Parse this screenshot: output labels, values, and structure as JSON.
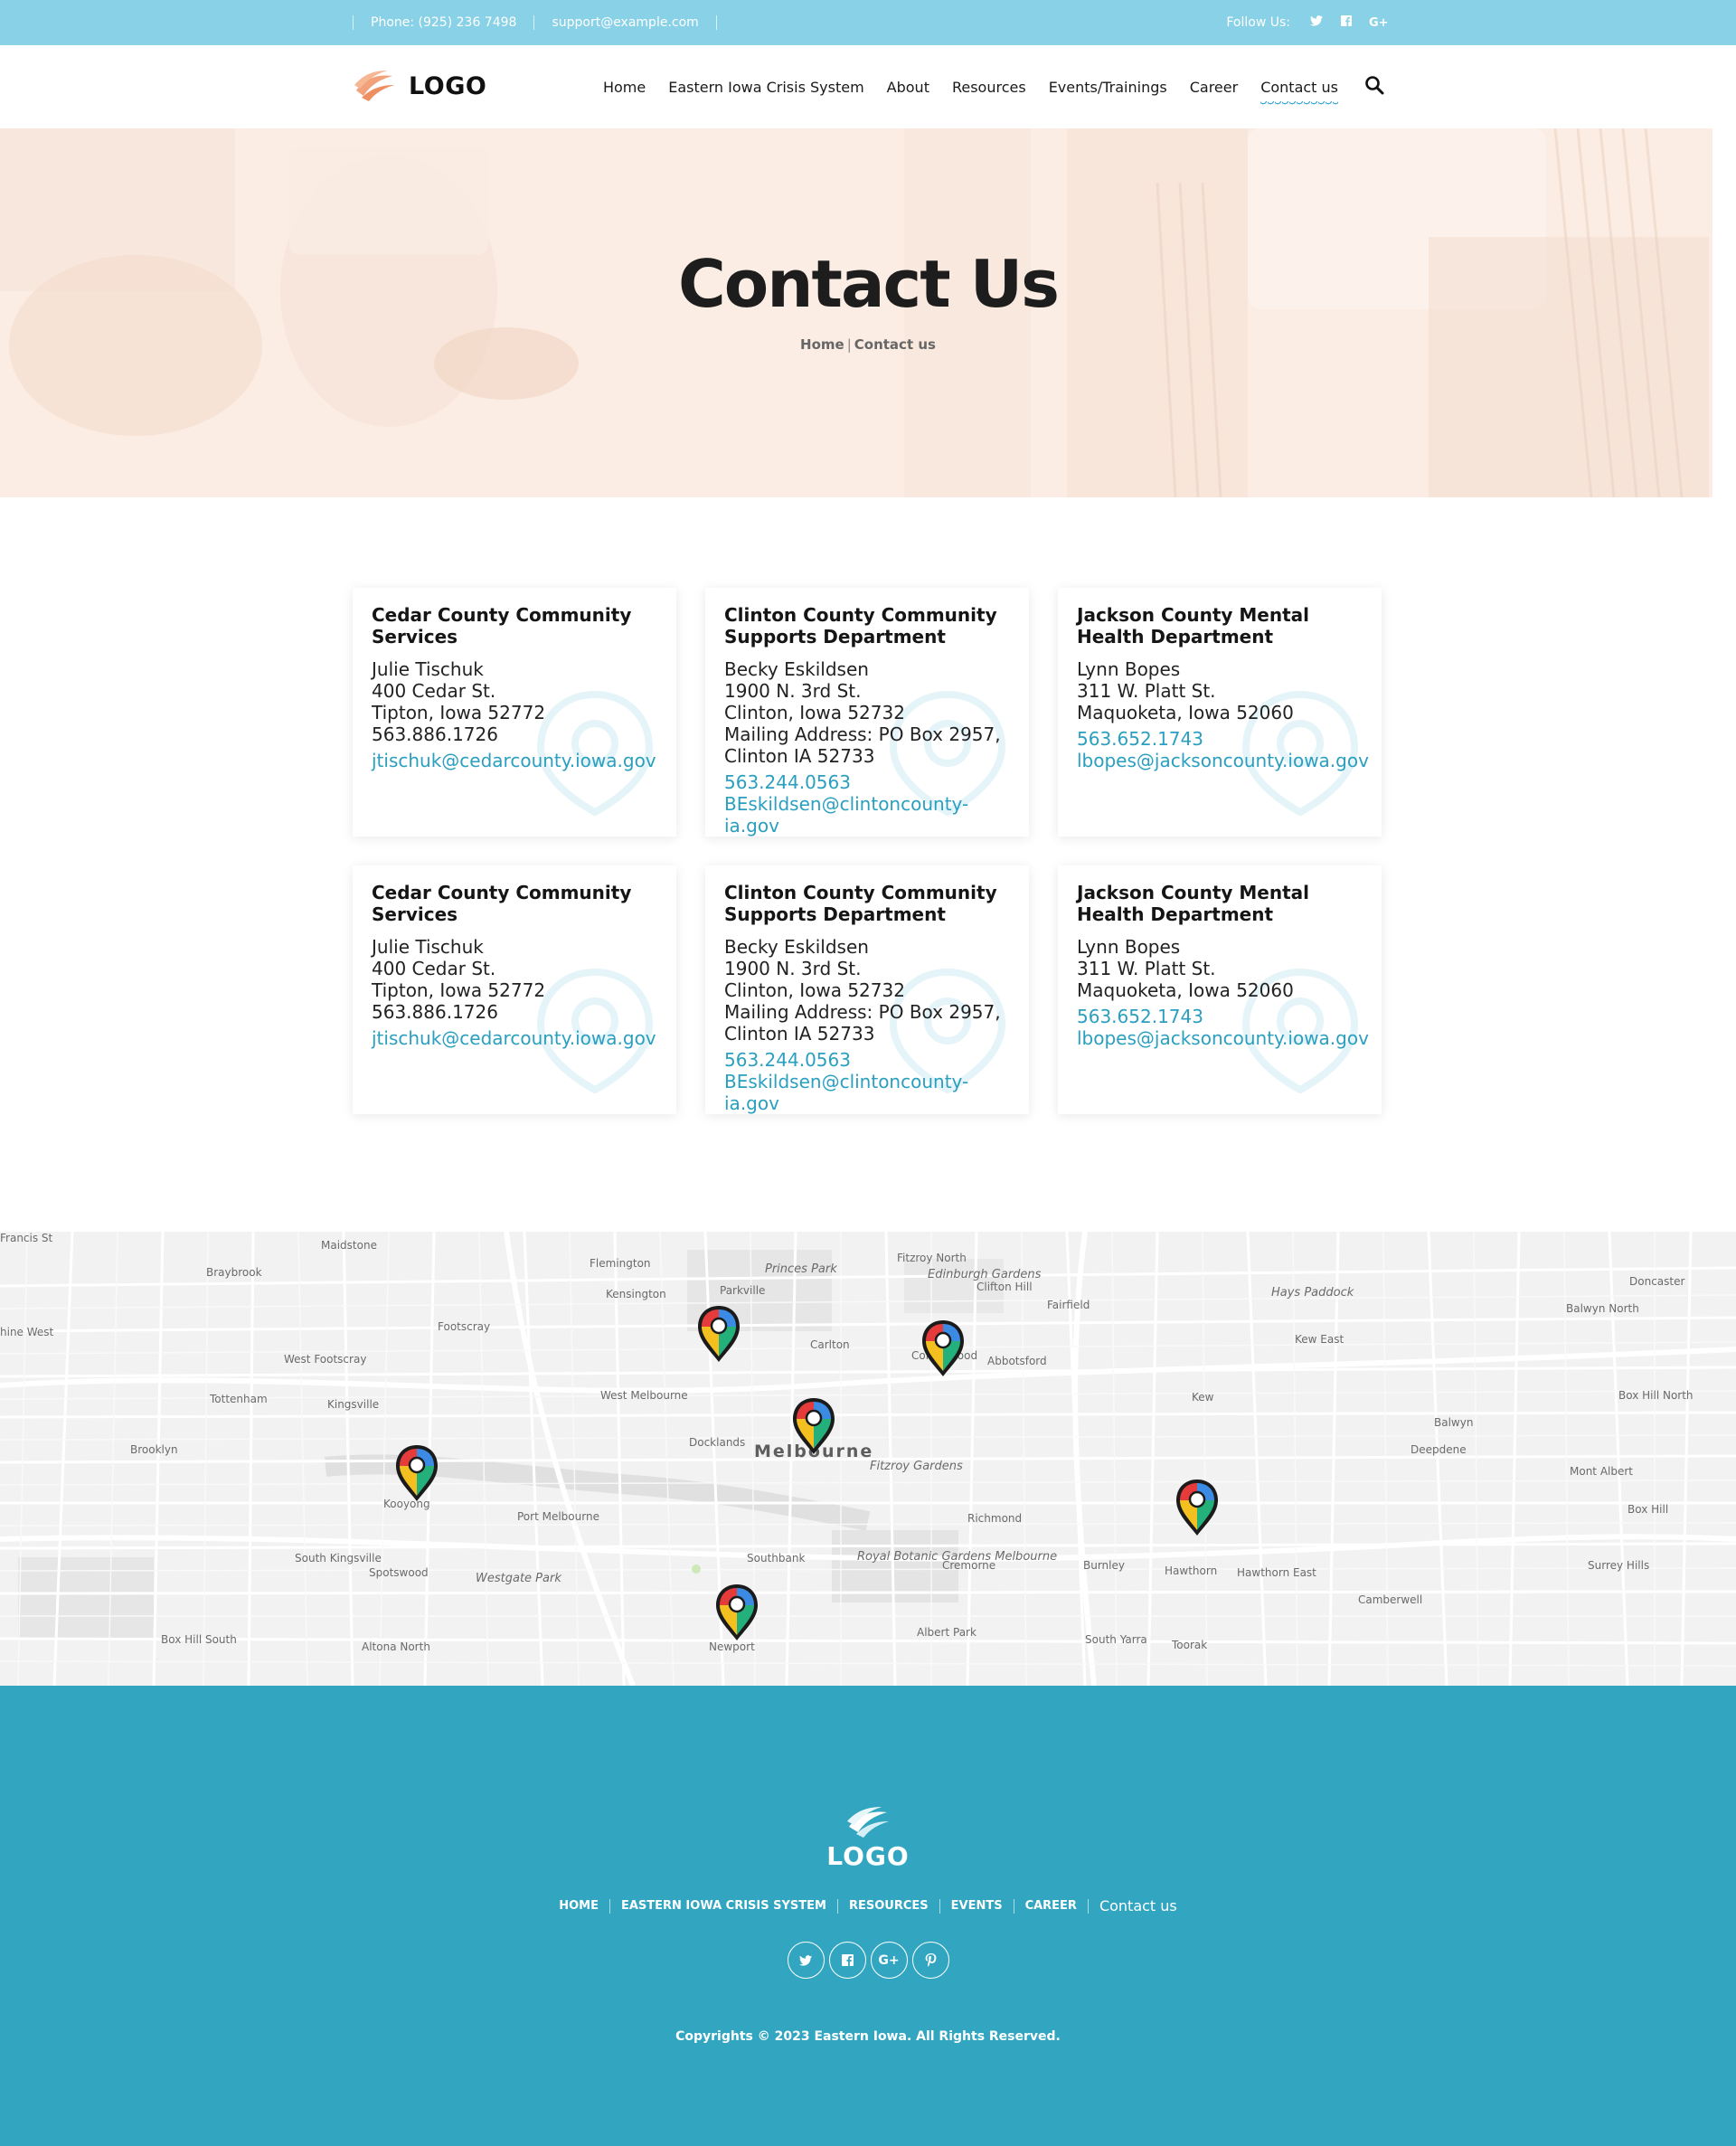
{
  "topbar": {
    "phone": "Phone: (925) 236 7498",
    "email": "support@example.com",
    "follow_label": "Follow Us:",
    "social": [
      {
        "icon": "twitter-icon",
        "glyph": "🐦"
      },
      {
        "icon": "facebook-icon",
        "glyph": "f"
      },
      {
        "icon": "google-plus-icon",
        "glyph": "G+"
      }
    ]
  },
  "header": {
    "logo_text": "LOGO",
    "nav": [
      {
        "label": "Home"
      },
      {
        "label": "Eastern Iowa Crisis System"
      },
      {
        "label": "About"
      },
      {
        "label": "Resources"
      },
      {
        "label": "Events/Trainings"
      },
      {
        "label": "Career"
      },
      {
        "label": "Contact us",
        "active": true
      }
    ],
    "search_icon": "search-icon"
  },
  "hero": {
    "title": "Contact Us",
    "breadcrumb_home": "Home",
    "breadcrumb_sep": "|",
    "breadcrumb_current": "Contact us"
  },
  "cards": [
    {
      "title": "Cedar County Community Services",
      "lines": [
        "Julie Tischuk",
        "400 Cedar St.",
        "Tipton, Iowa 52772",
        "563.886.1726"
      ],
      "links": [
        "jtischuk@cedarcounty.iowa.gov"
      ]
    },
    {
      "title": "Clinton County Community Supports Department",
      "lines": [
        "Becky Eskildsen",
        "1900 N. 3rd St.",
        "Clinton, Iowa 52732",
        "Mailing Address:  PO Box 2957,",
        "Clinton IA 52733"
      ],
      "links": [
        "563.244.0563",
        "BEskildsen@clintoncounty-ia.gov"
      ]
    },
    {
      "title": "Jackson County Mental Health Department",
      "lines": [
        "Lynn Bopes",
        "311 W. Platt St.",
        "Maquoketa, Iowa 52060"
      ],
      "links": [
        "563.652.1743",
        "lbopes@jacksoncounty.iowa.gov"
      ]
    },
    {
      "title": "Cedar County Community Services",
      "lines": [
        "Julie Tischuk",
        "400 Cedar St.",
        "Tipton, Iowa 52772",
        "563.886.1726"
      ],
      "links": [
        "jtischuk@cedarcounty.iowa.gov"
      ]
    },
    {
      "title": "Clinton County Community Supports Department",
      "lines": [
        "Becky Eskildsen",
        "1900 N. 3rd St.",
        "Clinton, Iowa 52732",
        "Mailing Address:  PO Box 2957,",
        "Clinton IA 52733"
      ],
      "links": [
        "563.244.0563",
        "BEskildsen@clintoncounty-ia.gov"
      ]
    },
    {
      "title": "Jackson County Mental Health Department",
      "lines": [
        "Lynn Bopes",
        "311 W. Platt St.",
        "Maquoketa, Iowa 52060"
      ],
      "links": [
        "563.652.1743",
        "lbopes@jacksoncounty.iowa.gov"
      ]
    }
  ],
  "map": {
    "city": "Melbourne",
    "labels": [
      "Maidstone",
      "Braybrook",
      "Flemington",
      "Princes Park",
      "Fitzroy North",
      "Edinburgh Gardens",
      "Clifton Hill",
      "Parkville",
      "Kensington",
      "Hays Paddock",
      "Doncaster",
      "Fairfield",
      "Balwyn North",
      "hine West",
      "Footscray",
      "West Footscray",
      "Carlton",
      "Collingwood",
      "Abbotsford",
      "Kew East",
      "Tottenham",
      "Kingsville",
      "West Melbourne",
      "Kew",
      "Box Hill North",
      "Brooklyn",
      "Docklands",
      "Fitzroy Gardens",
      "Balwyn",
      "Deepdene",
      "Mont Albert",
      "Port Melbourne",
      "Richmond",
      "Box Hill",
      "South Kingsville",
      "Spotswood",
      "Westgate Park",
      "Southbank",
      "Royal Botanic Gardens Melbourne",
      "Cremorne",
      "Burnley",
      "Hawthorn",
      "Hawthorn East",
      "Surrey Hills",
      "Camberwell",
      "Box Hill South",
      "Altona North",
      "Newport",
      "Albert Park",
      "South Yarra",
      "Toorak",
      "Kooyong",
      "Francis St"
    ],
    "pin_count": 6,
    "pin_icon": "map-pin-icon"
  },
  "footer": {
    "logo_text": "LOGO",
    "nav": [
      "HOME",
      "EASTERN IOWA CRISIS SYSTEM",
      "RESOURCES",
      "EVENTS",
      "CAREER",
      "Contact us"
    ],
    "social": [
      {
        "icon": "twitter-icon",
        "glyph": "🐦"
      },
      {
        "icon": "facebook-icon",
        "glyph": "f"
      },
      {
        "icon": "google-plus-icon",
        "glyph": "G+"
      },
      {
        "icon": "pinterest-icon",
        "glyph": "P"
      }
    ],
    "copyright": "Copyrights © 2023 Eastern Iowa. All Rights Reserved."
  },
  "colors": {
    "topbar": "#88d1e6",
    "accent": "#2a9fc0",
    "footer": "#32a6c1",
    "hero_tint": "#fbeee6",
    "logo_orange": "#f2a27a"
  }
}
